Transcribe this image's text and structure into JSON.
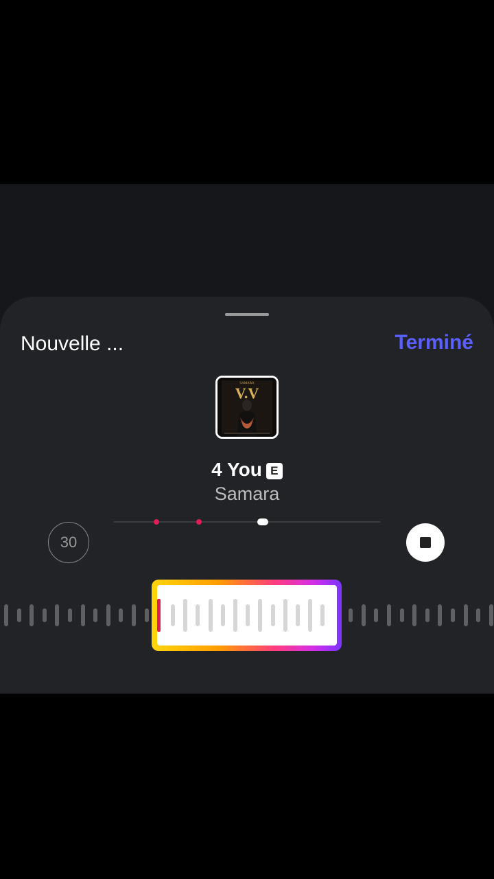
{
  "header": {
    "title": "Nouvelle ...",
    "done_label": "Terminé"
  },
  "album_art": {
    "text_top": "SAMARA",
    "text_main": "V.V"
  },
  "track": {
    "title": "4 You",
    "explicit_badge": "E",
    "artist": "Samara"
  },
  "controls": {
    "duration_label": "30",
    "stop_icon": "stop-icon"
  },
  "timeline": {
    "playhead_fraction": 0.56,
    "marker_fractions": [
      0.16,
      0.32
    ]
  },
  "colors": {
    "accent": "#5b5fff",
    "marker": "#e11d55",
    "sheet_background": "#222326"
  }
}
